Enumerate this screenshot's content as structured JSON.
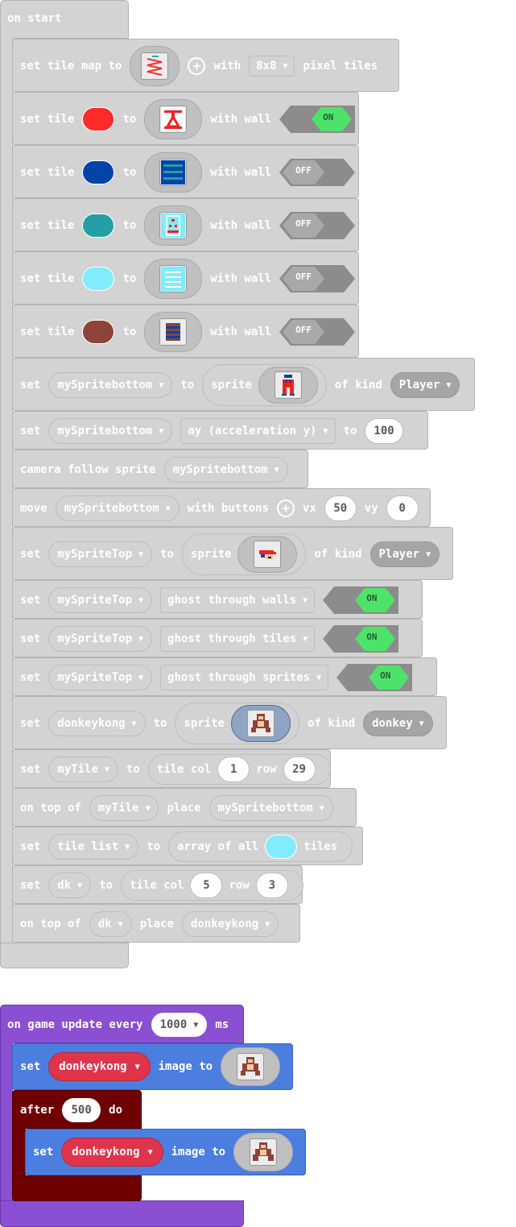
{
  "on_start": {
    "hat_label": "on start",
    "tilemap": {
      "kw": "set tile map to",
      "with": "with",
      "size": "8x8",
      "suffix": "pixel tiles"
    },
    "tiles": [
      {
        "set": "set tile",
        "to": "to",
        "color": "#ff2a2a",
        "wall_kw": "with wall",
        "wall": "ON"
      },
      {
        "set": "set tile",
        "to": "to",
        "color": "#0044aa",
        "wall_kw": "with wall",
        "wall": "OFF"
      },
      {
        "set": "set tile",
        "to": "to",
        "color": "#24a0a4",
        "wall_kw": "with wall",
        "wall": "OFF"
      },
      {
        "set": "set tile",
        "to": "to",
        "color": "#80ecfc",
        "wall_kw": "with wall",
        "wall": "OFF"
      },
      {
        "set": "set tile",
        "to": "to",
        "color": "#8c4438",
        "wall_kw": "with wall",
        "wall": "OFF"
      }
    ],
    "set_sprite_bottom": {
      "set": "set",
      "var": "mySpritebottom",
      "to": "to",
      "sprite": "sprite",
      "of_kind": "of kind",
      "kind": "Player"
    },
    "set_accel": {
      "set": "set",
      "var": "mySpritebottom",
      "prop": "ay (acceleration y)",
      "to": "to",
      "value": "100"
    },
    "camera": {
      "kw": "camera follow sprite",
      "var": "mySpritebottom"
    },
    "move": {
      "kw": "move",
      "var": "mySpritebottom",
      "with": "with buttons",
      "vx_kw": "vx",
      "vx": "50",
      "vy_kw": "vy",
      "vy": "0"
    },
    "set_sprite_top": {
      "set": "set",
      "var": "mySpriteTop",
      "to": "to",
      "sprite": "sprite",
      "of_kind": "of kind",
      "kind": "Player"
    },
    "ghost": [
      {
        "set": "set",
        "var": "mySpriteTop",
        "flag": "ghost through walls",
        "value": "ON"
      },
      {
        "set": "set",
        "var": "mySpriteTop",
        "flag": "ghost through tiles",
        "value": "ON"
      },
      {
        "set": "set",
        "var": "mySpriteTop",
        "flag": "ghost through sprites",
        "value": "ON"
      }
    ],
    "set_dk_sprite": {
      "set": "set",
      "var": "donkeykong",
      "to": "to",
      "sprite": "sprite",
      "of_kind": "of kind",
      "kind": "donkey"
    },
    "set_mytile": {
      "set": "set",
      "var": "myTile",
      "to": "to",
      "tile_col": "tile col",
      "col": "1",
      "row_kw": "row",
      "row": "29"
    },
    "place1": {
      "kw": "on top of",
      "var": "myTile",
      "place": "place",
      "target": "mySpritebottom"
    },
    "tile_list": {
      "set": "set",
      "var": "tile list",
      "to": "to",
      "array": "array of all",
      "chip_color": "#80ecfc",
      "suffix": "tiles"
    },
    "set_dk": {
      "set": "set",
      "var": "dk",
      "to": "to",
      "tile_col": "tile col",
      "col": "5",
      "row_kw": "row",
      "row": "3"
    },
    "place2": {
      "kw": "on top of",
      "var": "dk",
      "place": "place",
      "target": "donkeykong"
    }
  },
  "on_update": {
    "hat_label": "on game update every",
    "interval": "1000",
    "unit": "ms",
    "set1": {
      "set": "set",
      "var": "donkeykong",
      "image_to": "image to"
    },
    "after": {
      "kw": "after",
      "value": "500",
      "do": "do"
    },
    "set2": {
      "set": "set",
      "var": "donkeykong",
      "image_to": "image to"
    }
  },
  "colors": {
    "gray_block": "#d3d3d3",
    "purple_event": "#8a4fd3",
    "blue_sprite": "#4c7ee0",
    "maroon_loop": "#6f0000",
    "toggle_on": "#4de36a"
  }
}
